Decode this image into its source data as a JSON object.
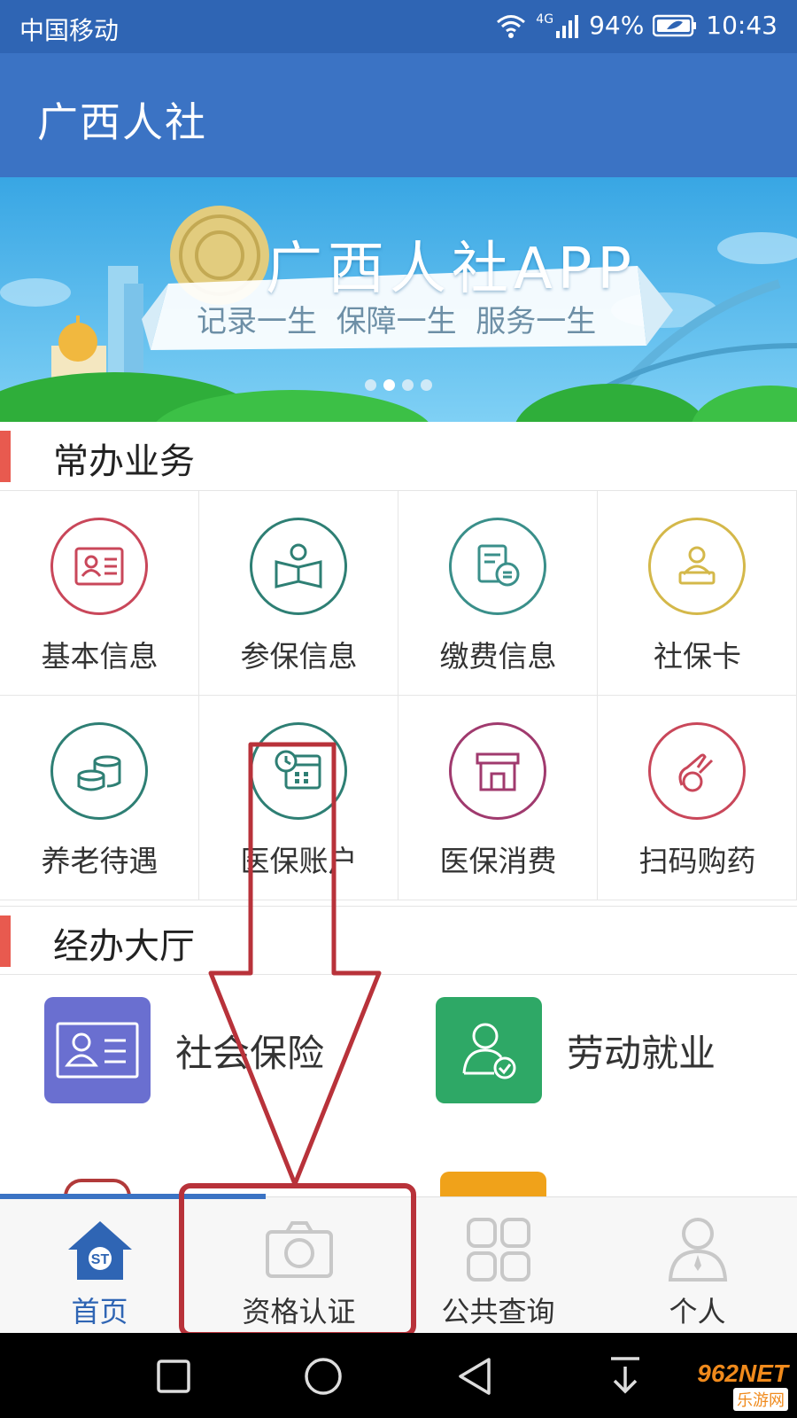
{
  "status_bar": {
    "carrier": "中国移动",
    "network": "4G",
    "battery": "94%",
    "time": "10:43"
  },
  "app_bar": {
    "title": "广西人社"
  },
  "banner": {
    "headline": "广西人社APP",
    "slogan": "记录一生  保障一生  服务一生",
    "active_slide": 2,
    "slide_count": 4
  },
  "sections": {
    "common": {
      "title": "常办业务"
    },
    "hall": {
      "title": "经办大厅"
    }
  },
  "common_services": [
    {
      "label": "基本信息",
      "icon": "id-card-icon",
      "color": "#c9475a"
    },
    {
      "label": "参保信息",
      "icon": "reading-person-icon",
      "color": "#2e7f74"
    },
    {
      "label": "缴费信息",
      "icon": "payment-document-icon",
      "color": "#3a8f8a"
    },
    {
      "label": "社保卡",
      "icon": "person-computer-icon",
      "color": "#d4b84a"
    },
    {
      "label": "养老待遇",
      "icon": "coins-icon",
      "color": "#2e7f74"
    },
    {
      "label": "医保账户",
      "icon": "calendar-clock-icon",
      "color": "#2e7f74"
    },
    {
      "label": "医保消费",
      "icon": "store-icon",
      "color": "#a03a6e"
    },
    {
      "label": "扫码购药",
      "icon": "hand-pill-icon",
      "color": "#c9475a"
    }
  ],
  "hall_services": [
    {
      "label": "社会保险",
      "icon": "id-card-icon",
      "color": "#6a6fd0"
    },
    {
      "label": "劳动就业",
      "icon": "user-check-icon",
      "color": "#2ea866"
    }
  ],
  "bottom_nav": [
    {
      "label": "首页",
      "icon": "home-icon",
      "active": true
    },
    {
      "label": "资格认证",
      "icon": "camera-icon",
      "active": false
    },
    {
      "label": "公共查询",
      "icon": "grid-icon",
      "active": false
    },
    {
      "label": "个人",
      "icon": "person-icon",
      "active": false
    }
  ],
  "watermark": {
    "brand": "962NET",
    "sub": "乐游网"
  }
}
